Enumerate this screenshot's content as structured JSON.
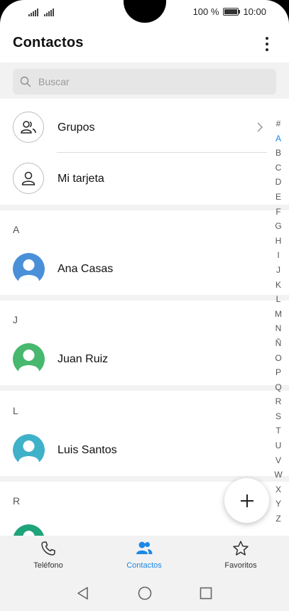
{
  "status": {
    "battery": "100 %",
    "time": "10:00"
  },
  "header": {
    "title": "Contactos"
  },
  "search": {
    "placeholder": "Buscar"
  },
  "rows": {
    "groups": "Grupos",
    "my_card": "Mi tarjeta"
  },
  "sections": [
    {
      "letter": "A",
      "name": "Ana Casas",
      "color": "#4a90d9"
    },
    {
      "letter": "J",
      "name": "Juan Ruiz",
      "color": "#47b86e"
    },
    {
      "letter": "L",
      "name": "Luis Santos",
      "color": "#3fb1c9"
    },
    {
      "letter": "R",
      "name": "",
      "color": "#1fa37a"
    }
  ],
  "alphabet": [
    "#",
    "A",
    "B",
    "C",
    "D",
    "E",
    "F",
    "G",
    "H",
    "I",
    "J",
    "K",
    "L",
    "M",
    "N",
    "Ñ",
    "O",
    "P",
    "Q",
    "R",
    "S",
    "T",
    "U",
    "V",
    "W",
    "X",
    "Y",
    "Z"
  ],
  "alphabet_active": "A",
  "tabs": [
    {
      "label": "Teléfono",
      "icon": "phone-icon"
    },
    {
      "label": "Contactos",
      "icon": "contacts-icon"
    },
    {
      "label": "Favoritos",
      "icon": "star-icon"
    }
  ],
  "colors": {
    "accent": "#1e88e5"
  }
}
